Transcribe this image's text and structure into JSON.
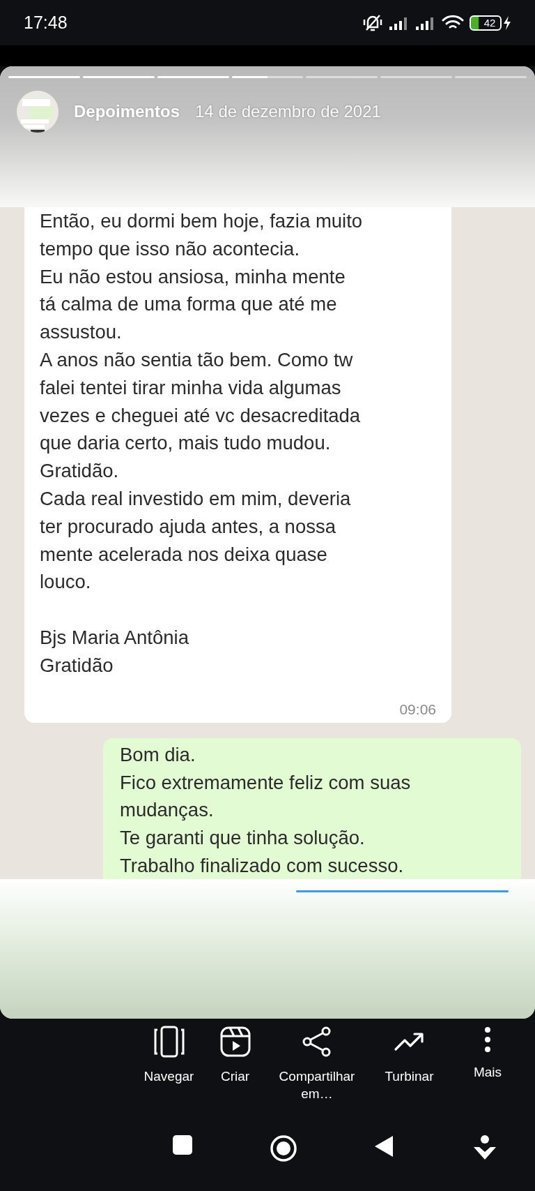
{
  "status_bar": {
    "time": "17:48",
    "battery": "42"
  },
  "story": {
    "segments": [
      {
        "kind": "seen",
        "level": 1
      },
      {
        "kind": "seen",
        "level": 1
      },
      {
        "kind": "seen",
        "level": 1
      },
      {
        "kind": "current",
        "level": 0.5
      },
      {
        "kind": "upcoming"
      },
      {
        "kind": "upcoming"
      },
      {
        "kind": "upcoming"
      }
    ],
    "title": "Depoimentos",
    "date": "14 de dezembro de 2021"
  },
  "messages": [
    {
      "kind": "received",
      "paragraphs": [
        [
          "Então, eu dormi bem hoje, fazia muito",
          "tempo que isso não acontecia.",
          "Eu não estou ansiosa, minha mente",
          "tá calma de uma forma que até me",
          "assustou.",
          "A anos não sentia tão bem. Como tw",
          "falei tentei tirar minha vida algumas",
          "vezes e cheguei até vc desacreditada",
          "que daria certo, mais tudo mudou.",
          "Gratidão.",
          "Cada real investido em mim, deveria",
          "ter procurado ajuda antes, a nossa",
          "mente acelerada nos deixa quase",
          "louco."
        ],
        [
          "Bjs Maria Antônia",
          "Gratidão"
        ]
      ],
      "time": "09:06"
    },
    {
      "kind": "sent",
      "paragraphs": [
        [
          "Bom dia.",
          "Fico extremamente feliz com suas",
          "mudanças.",
          "Te garanti que tinha solução.",
          "Trabalho finalizado com sucesso."
        ]
      ]
    }
  ],
  "actions": [
    {
      "label": "Navegar"
    },
    {
      "label": "Criar"
    },
    {
      "label": "Compartilhar em…"
    },
    {
      "label": "Turbinar"
    },
    {
      "label": "Mais"
    }
  ]
}
